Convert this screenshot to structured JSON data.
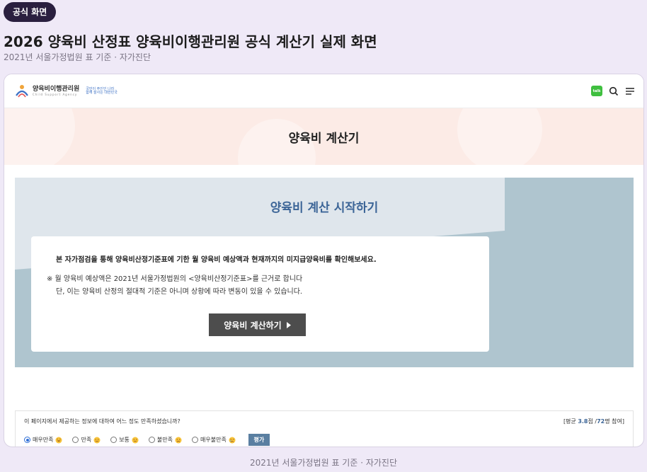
{
  "badge": "공식 화면",
  "page_title": "2026 양육비 산정표 양육비이행관리원 공식 계산기 실제 화면",
  "page_subtitle": "2021년 서울가정법원 표 기준 · 자가진단",
  "site": {
    "logo_name": "양육비이행관리원",
    "logo_sub": "Child Support Agency",
    "gov_line1": "국민이 주인인 나라",
    "gov_line2": "함께 잘사는 대한민국",
    "kakao_label": "talk",
    "search_icon": "search-icon",
    "menu_icon": "menu-icon"
  },
  "hero": {
    "title": "양육비 계산기"
  },
  "calc": {
    "title": "양육비 계산 시작하기",
    "lead": "본 자가점검을 통해 양육비산정기준표에 기한 월 양육비 예상액과 현재까지의 미지급양육비를 확인해보세요.",
    "note1": "※ 월 양육비 예상액은 2021년 서울가정법원의 <양육비산정기준표>를 근거로 합니다",
    "note2": "단, 이는 양육비 산정의 절대적 기준은 아니며 상황에 따라 변동이 있을 수 있습니다.",
    "button_label": "양육비 계산하기",
    "colors": {
      "panel": "#afc5cf",
      "title": "#3c6597",
      "button": "#4d4d4d"
    }
  },
  "survey": {
    "question": "이 페이지에서 제공하는 정보에 대하여 어느 정도 만족하셨습니까?",
    "stats_prefix": "[평균 ",
    "stats_score": "3.8",
    "stats_mid": "점 /",
    "stats_count": "72",
    "stats_suffix": "명 참여]",
    "options": [
      {
        "label": "매우만족",
        "checked": true
      },
      {
        "label": "만족",
        "checked": false
      },
      {
        "label": "보통",
        "checked": false
      },
      {
        "label": "불만족",
        "checked": false
      },
      {
        "label": "매우불만족",
        "checked": false
      }
    ],
    "rate_label": "평가"
  },
  "footer_caption": "2021년 서울가정법원 표 기준 · 자가진단"
}
